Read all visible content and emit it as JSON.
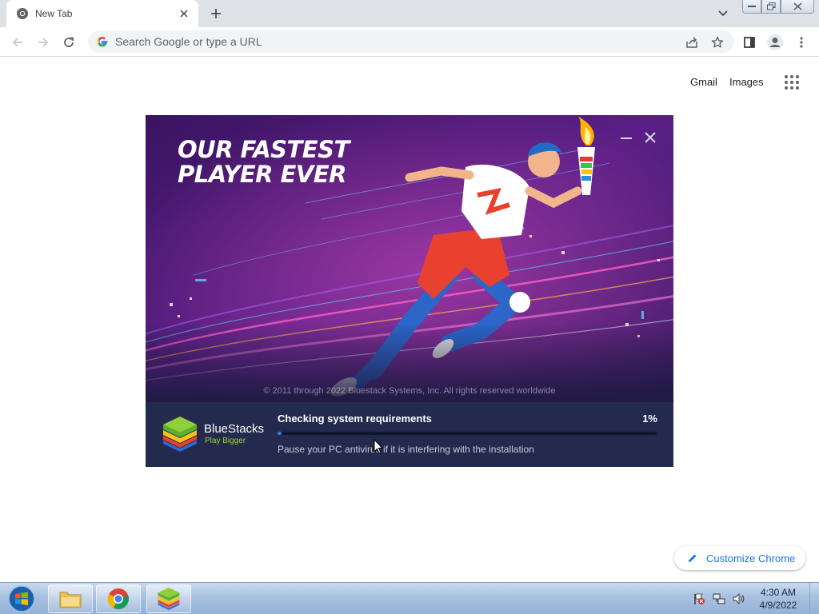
{
  "browser": {
    "tab": {
      "title": "New Tab"
    },
    "omnibox": {
      "placeholder": "Search Google or type a URL"
    }
  },
  "ntp": {
    "gmail_label": "Gmail",
    "images_label": "Images",
    "customize_label": "Customize Chrome"
  },
  "installer": {
    "headline_line1": "OUR FASTEST",
    "headline_line2": "PLAYER EVER",
    "copyright": "© 2011 through 2022 Bluestack Systems, Inc. All rights reserved worldwide",
    "brand_name": "BlueStacks",
    "brand_tagline": "Play Bigger",
    "status": "Checking system requirements",
    "percent_label": "1%",
    "progress_fraction": 0.01,
    "hint": "Pause your PC antivirus if it is interfering with the installation"
  },
  "taskbar": {
    "apps": [
      "file-explorer",
      "google-chrome",
      "bluestacks"
    ],
    "clock_time": "4:30 AM",
    "clock_date": "4/9/2022"
  },
  "colors": {
    "chrome_accent": "#1a73e8",
    "installer_footer": "#232a4e",
    "progress_blue": "#2f7de1",
    "bluestacks_green": "#9ccf3c"
  }
}
